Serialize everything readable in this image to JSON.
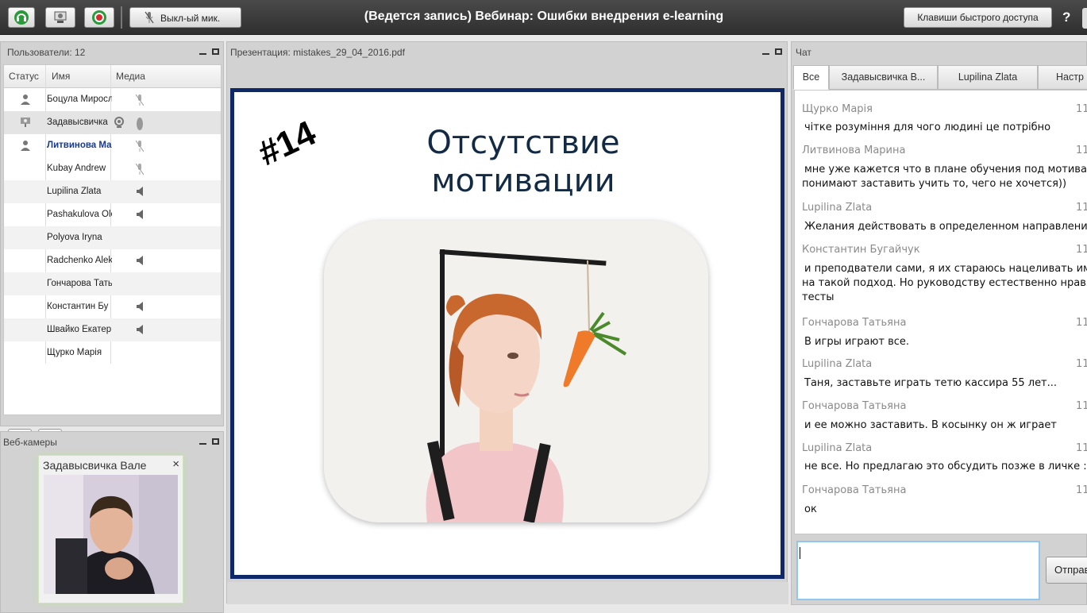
{
  "toolbar": {
    "mic_label": "Выкл-ый мик.",
    "title": "(Ведется запись) Вебинар: Ошибки внедрения e-learning",
    "shortcuts_label": "Клавиши быстрого доступа",
    "help_label": "?"
  },
  "users": {
    "title": "Пользователи: 12",
    "columns": [
      "Статус",
      "Имя",
      "Медиа"
    ],
    "rows": [
      {
        "name": "Боцула Миросл",
        "status": "person",
        "media": "mic-off"
      },
      {
        "name": "Задавысвичка",
        "status": "presenter",
        "media": "webcam+mic"
      },
      {
        "name": "Литвинова Ма",
        "status": "person",
        "media": "mic-off"
      },
      {
        "name": "Kubay Andrew",
        "status": "",
        "media": "mic-off"
      },
      {
        "name": "Lupilina Zlata",
        "status": "",
        "media": "speaker"
      },
      {
        "name": "Pashakulova Ole",
        "status": "",
        "media": "speaker"
      },
      {
        "name": "Polyova Iryna",
        "status": "",
        "media": ""
      },
      {
        "name": "Radchenko Alek",
        "status": "",
        "media": "speaker"
      },
      {
        "name": "Гончарова Тать",
        "status": "",
        "media": ""
      },
      {
        "name": "Константин Бу",
        "status": "",
        "media": "speaker"
      },
      {
        "name": "Швайко Екатер",
        "status": "",
        "media": "speaker"
      },
      {
        "name": "Щурко Марія",
        "status": "",
        "media": ""
      }
    ]
  },
  "webcams": {
    "title": "Веб-камеры",
    "cam_name": "Задавысвичка Вале",
    "close_label": "×"
  },
  "presentation": {
    "title": "Презентация: mistakes_29_04_2016.pdf",
    "slide_number": "#14",
    "slide_title_line1": "Отсутствие",
    "slide_title_line2": "мотивации"
  },
  "chat": {
    "title": "Чат",
    "tabs": [
      "Все",
      "Задавысвичка В...",
      "Lupilina Zlata",
      "Настр"
    ],
    "messages": [
      {
        "sender": "Щурко Марія",
        "time": "11",
        "lines": [
          "чітке розуміння для чого людині це потрібно"
        ]
      },
      {
        "sender": "Литвинова Марина",
        "time": "11",
        "lines": [
          "мне уже кажется что в плане обучения под мотиваци",
          "понимают заставить учить то, чего не хочется))"
        ]
      },
      {
        "sender": "Lupilina Zlata",
        "time": "11",
        "lines": [
          "Желания действовать в определенном направлении"
        ]
      },
      {
        "sender": "Константин Бугайчук",
        "time": "11",
        "lines": [
          "и преподватели сами, я их стараюсь нацеливать имен",
          "на такой подход. Но руководству естественно нравят",
          "тесты"
        ]
      },
      {
        "sender": "Гончарова Татьяна",
        "time": "11",
        "lines": [
          "В игры играют все."
        ]
      },
      {
        "sender": "Lupilina Zlata",
        "time": "11",
        "lines": [
          "Таня, заставьте играть тетю кассира 55 лет..."
        ]
      },
      {
        "sender": "Гончарова Татьяна",
        "time": "11",
        "lines": [
          "и ее можно заставить. В косынку он ж играет"
        ]
      },
      {
        "sender": "Lupilina Zlata",
        "time": "11",
        "lines": [
          "не все. Но предлагаю это обсудить позже в личке :-)"
        ]
      },
      {
        "sender": "Гончарова Татьяна",
        "time": "11",
        "lines": [
          "ок"
        ]
      }
    ],
    "input_value": "",
    "send_label": "Отправ"
  }
}
